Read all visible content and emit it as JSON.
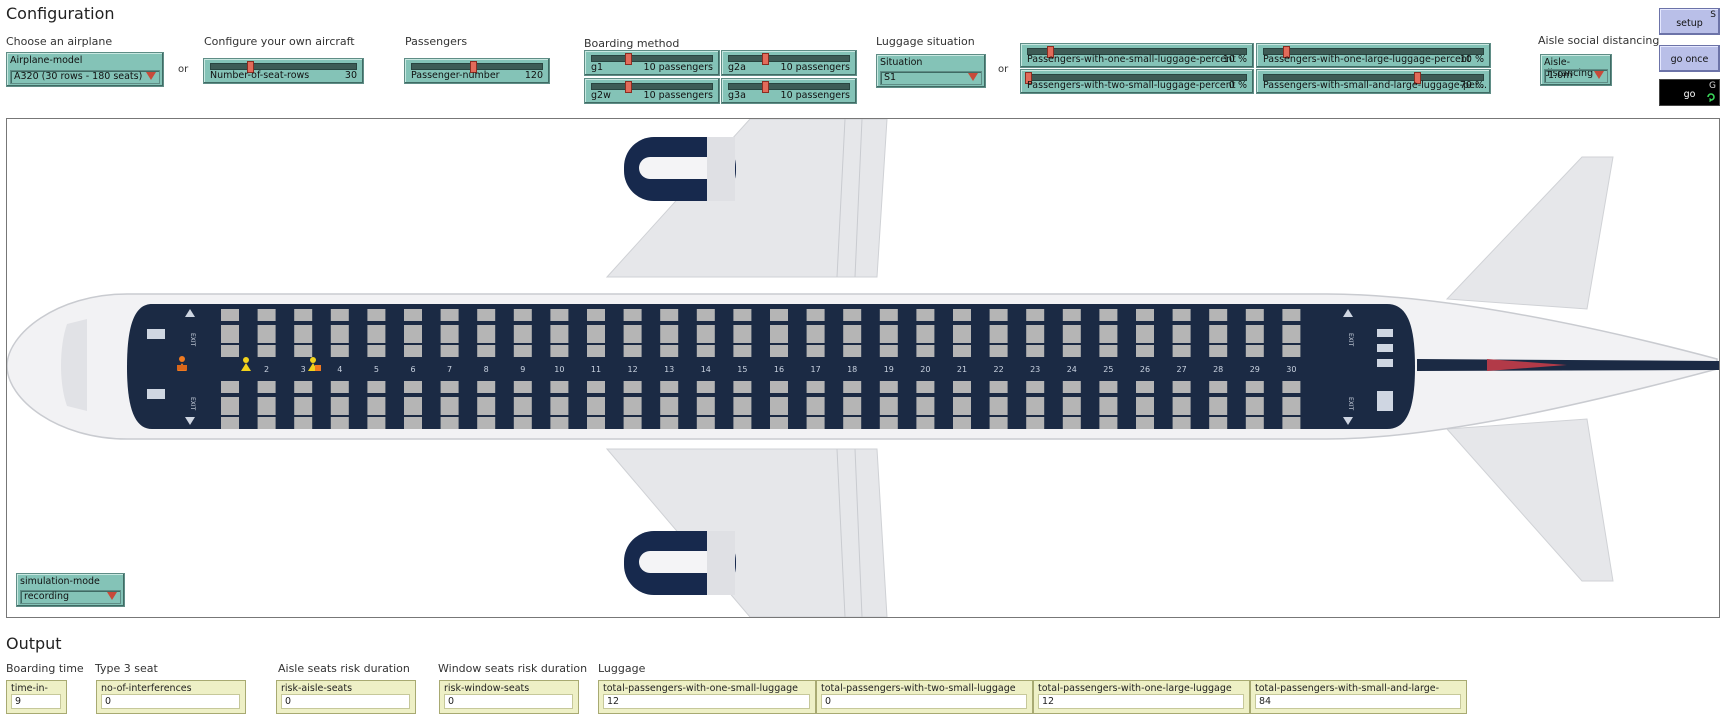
{
  "config": {
    "title": "Configuration",
    "choose_airplane": {
      "heading": "Choose an airplane",
      "chooser_label": "Airplane-model",
      "chooser_value": "A320 (30 rows - 180 seats)"
    },
    "or_label": "or",
    "own_aircraft": {
      "heading": "Configure your own aircraft",
      "slider_label": "Number-of-seat-rows",
      "slider_value": "30",
      "slider_fraction": 0.27
    },
    "passengers": {
      "heading": "Passengers",
      "slider_label": "Passenger-number",
      "slider_value": "120",
      "slider_fraction": 0.47
    },
    "boarding": {
      "heading": "Boarding method",
      "sliders": [
        {
          "label": "g1",
          "value": "10 passengers",
          "fraction": 0.3
        },
        {
          "label": "g2a",
          "value": "10 passengers",
          "fraction": 0.3
        },
        {
          "label": "g2w",
          "value": "10 passengers",
          "fraction": 0.3
        },
        {
          "label": "g3a",
          "value": "10 passengers",
          "fraction": 0.3
        }
      ]
    },
    "luggage": {
      "heading": "Luggage situation",
      "chooser_label": "Situation",
      "chooser_value": "S1",
      "sliders": [
        {
          "label": "Passengers-with-one-small-luggage-percent",
          "value": "10 %",
          "fraction": 0.1
        },
        {
          "label": "Passengers-with-one-large-luggage-percent",
          "value": "10 %",
          "fraction": 0.1
        },
        {
          "label": "Passengers-with-two-small-luggage-percent",
          "value": "0 %",
          "fraction": 0.0
        },
        {
          "label": "Passengers-with-small-and-large-luggage-per...",
          "value": "70 %",
          "fraction": 0.7
        }
      ]
    },
    "aisle": {
      "heading": "Aisle social distancing",
      "chooser_label": "Aisle-distancing",
      "chooser_value": "1.0m"
    },
    "buttons": {
      "setup_label": "setup",
      "setup_key": "S",
      "go_once_label": "go once",
      "go_label": "go",
      "go_key": "G"
    }
  },
  "world": {
    "row_numbers": [
      "2",
      "3",
      "4",
      "5",
      "6",
      "7",
      "8",
      "9",
      "10",
      "11",
      "12",
      "13",
      "14",
      "15",
      "16",
      "17",
      "18",
      "19",
      "20",
      "21",
      "22",
      "23",
      "24",
      "25",
      "26",
      "27",
      "28",
      "29",
      "30"
    ],
    "exit_label": "EXIT",
    "colors": {
      "cabin": "#1b2a44",
      "seat": "#b5b5b5",
      "fuselage": "#f2f2f4",
      "wing": "#e6e7ea",
      "engine": "#17294d",
      "passenger_yellow": "#f2d21b",
      "passenger_orange": "#f07a20",
      "tail_stripe": "#b23a48"
    },
    "simulation_mode": {
      "label": "simulation-mode",
      "value": "recording"
    }
  },
  "output": {
    "title": "Output",
    "groups": [
      {
        "heading": "Boarding time",
        "monitor_label": "time-in-ticks",
        "value": "9"
      },
      {
        "heading": "Type 3 seat",
        "monitor_label": "no-of-interferences",
        "value": "0"
      },
      {
        "heading": "Aisle seats risk duration",
        "monitor_label": "risk-aisle-seats",
        "value": "0"
      },
      {
        "heading": "Window seats risk duration",
        "monitor_label": "risk-window-seats",
        "value": "0"
      },
      {
        "heading": "Luggage",
        "monitor_label": "total-passengers-with-one-small-luggage",
        "value": "12"
      },
      {
        "heading": "",
        "monitor_label": "total-passengers-with-two-small-luggage",
        "value": "0"
      },
      {
        "heading": "",
        "monitor_label": "total-passengers-with-one-large-luggage",
        "value": "12"
      },
      {
        "heading": "",
        "monitor_label": "total-passengers-with-small-and-large-luggage",
        "value": "84"
      }
    ]
  }
}
